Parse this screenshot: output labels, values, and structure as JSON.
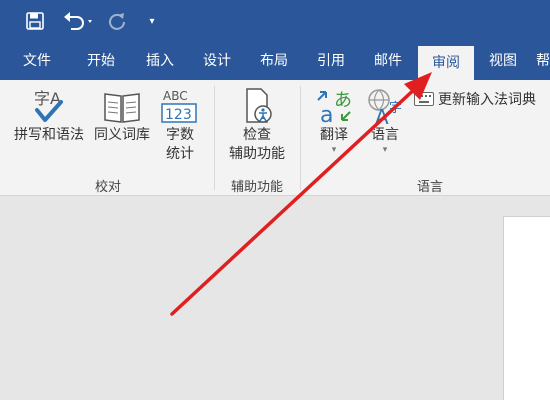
{
  "qat": {
    "save_icon": "save-icon",
    "undo_icon": "undo-icon",
    "redo_icon": "redo-icon",
    "customize_icon": "customize-icon",
    "customize_glyph": "▾"
  },
  "tabs": [
    {
      "label": "文件"
    },
    {
      "label": "开始"
    },
    {
      "label": "插入"
    },
    {
      "label": "设计"
    },
    {
      "label": "布局"
    },
    {
      "label": "引用"
    },
    {
      "label": "邮件"
    },
    {
      "label": "审阅",
      "active": true
    },
    {
      "label": "视图"
    },
    {
      "label": "帮"
    }
  ],
  "ribbon": {
    "proofing": {
      "spelling_grammar": "拼写和语法",
      "thesaurus": "同义词库",
      "word_count_line1": "字数",
      "word_count_line2": "统计",
      "group_label": "校对",
      "spelling_icon_text": "字A",
      "word_count_icon_text1": "ABC",
      "word_count_icon_text2": "123"
    },
    "accessibility": {
      "check_line1": "检查",
      "check_line2": "辅助功能",
      "group_label": "辅助功能"
    },
    "language": {
      "translate": "翻译",
      "language": "语言",
      "ime_dictionary": "更新输入法词典",
      "group_label": "语言"
    }
  },
  "colors": {
    "titlebar": "#2b579a",
    "ribbon": "#f3f3f3",
    "canvas": "#e6e6e6",
    "annotation_arrow": "#e02020"
  }
}
